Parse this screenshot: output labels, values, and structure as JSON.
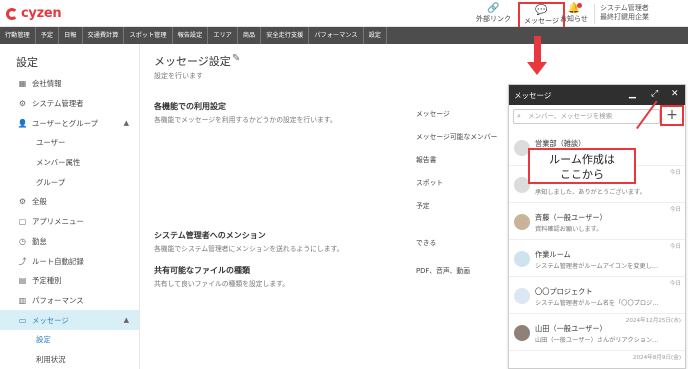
{
  "header": {
    "logo_text": "cyzen",
    "external_link": "外部リンク",
    "message": "メッセージ",
    "notice": "お知らせ",
    "user_role": "システム管理者",
    "user_company": "最終打鍵用企業"
  },
  "nav": [
    "行動管理",
    "予定",
    "日報",
    "交通費計算",
    "スポット管理",
    "報告設定",
    "エリア",
    "商品",
    "安全走行支援",
    "パフォーマンス",
    "設定"
  ],
  "sidebar": {
    "title": "設定",
    "items": [
      {
        "label": "会社情報",
        "icon": "building-icon"
      },
      {
        "label": "システム管理者",
        "icon": "admin-icon"
      },
      {
        "label": "ユーザーとグループ",
        "icon": "user-icon"
      },
      {
        "label": "ユーザー"
      },
      {
        "label": "メンバー属性"
      },
      {
        "label": "グループ"
      },
      {
        "label": "全般",
        "icon": "gear-icon"
      },
      {
        "label": "アプリメニュー",
        "icon": "app-menu-icon"
      },
      {
        "label": "勤怠",
        "icon": "clock-icon"
      },
      {
        "label": "ルート自動記録",
        "icon": "route-icon"
      },
      {
        "label": "予定種別",
        "icon": "calendar-icon"
      },
      {
        "label": "パフォーマンス",
        "icon": "chart-icon"
      },
      {
        "label": "メッセージ",
        "icon": "chat-icon"
      },
      {
        "label": "設定"
      },
      {
        "label": "利用状況"
      }
    ]
  },
  "main": {
    "title": "メッセージ設定",
    "subtitle": "設定を行います",
    "section1_title": "各機能での利用設定",
    "section1_desc": "各機能でメッセージを利用するかどうかの設定を行います。",
    "section1_rows": [
      "メッセージ",
      "メッセージ可能なメンバー",
      "報告書",
      "スポット",
      "予定"
    ],
    "section2_title": "システム管理者へのメンション",
    "section2_desc": "各機能でシステム管理者にメンションを送れるようにします。",
    "section2_value": "できる",
    "section3_title": "共有可能なファイルの種類",
    "section3_desc": "共有して良いファイルの種類を設定します。",
    "section3_value": "PDF、音声、動画"
  },
  "panel": {
    "title": "メッセージ",
    "search_placeholder": "メンバー、メッセージを検索",
    "plus": "+",
    "rooms": [
      {
        "name": "営業部（雑談）",
        "message": "",
        "date": ""
      },
      {
        "name": "",
        "message": "承知しました、ありがとうございます。",
        "date": "今日"
      },
      {
        "name": "斉藤（一般ユーザー）",
        "message": "資料確認お願いします。",
        "date": "今日"
      },
      {
        "name": "作業ルーム",
        "message": "システム管理者がルームアイコンを変更し…",
        "date": "今日"
      },
      {
        "name": "〇〇プロジェクト",
        "message": "システム管理者がルーム名を「〇〇プロジ…",
        "date": "今日"
      },
      {
        "name": "山田（一般ユーザー）",
        "message": "山田（一般ユーザー）さんがリアクション…",
        "date": "2024年12月25日(水)"
      }
    ],
    "last_date": "2024年8月9日(金)"
  },
  "callout": {
    "line1": "ルーム作成は",
    "line2": "ここから"
  },
  "colors": {
    "accent_red": "#e8383d",
    "nav_bg": "#4d4d4d",
    "active_bg": "#d9eff8",
    "active_text": "#2a7fb8"
  }
}
